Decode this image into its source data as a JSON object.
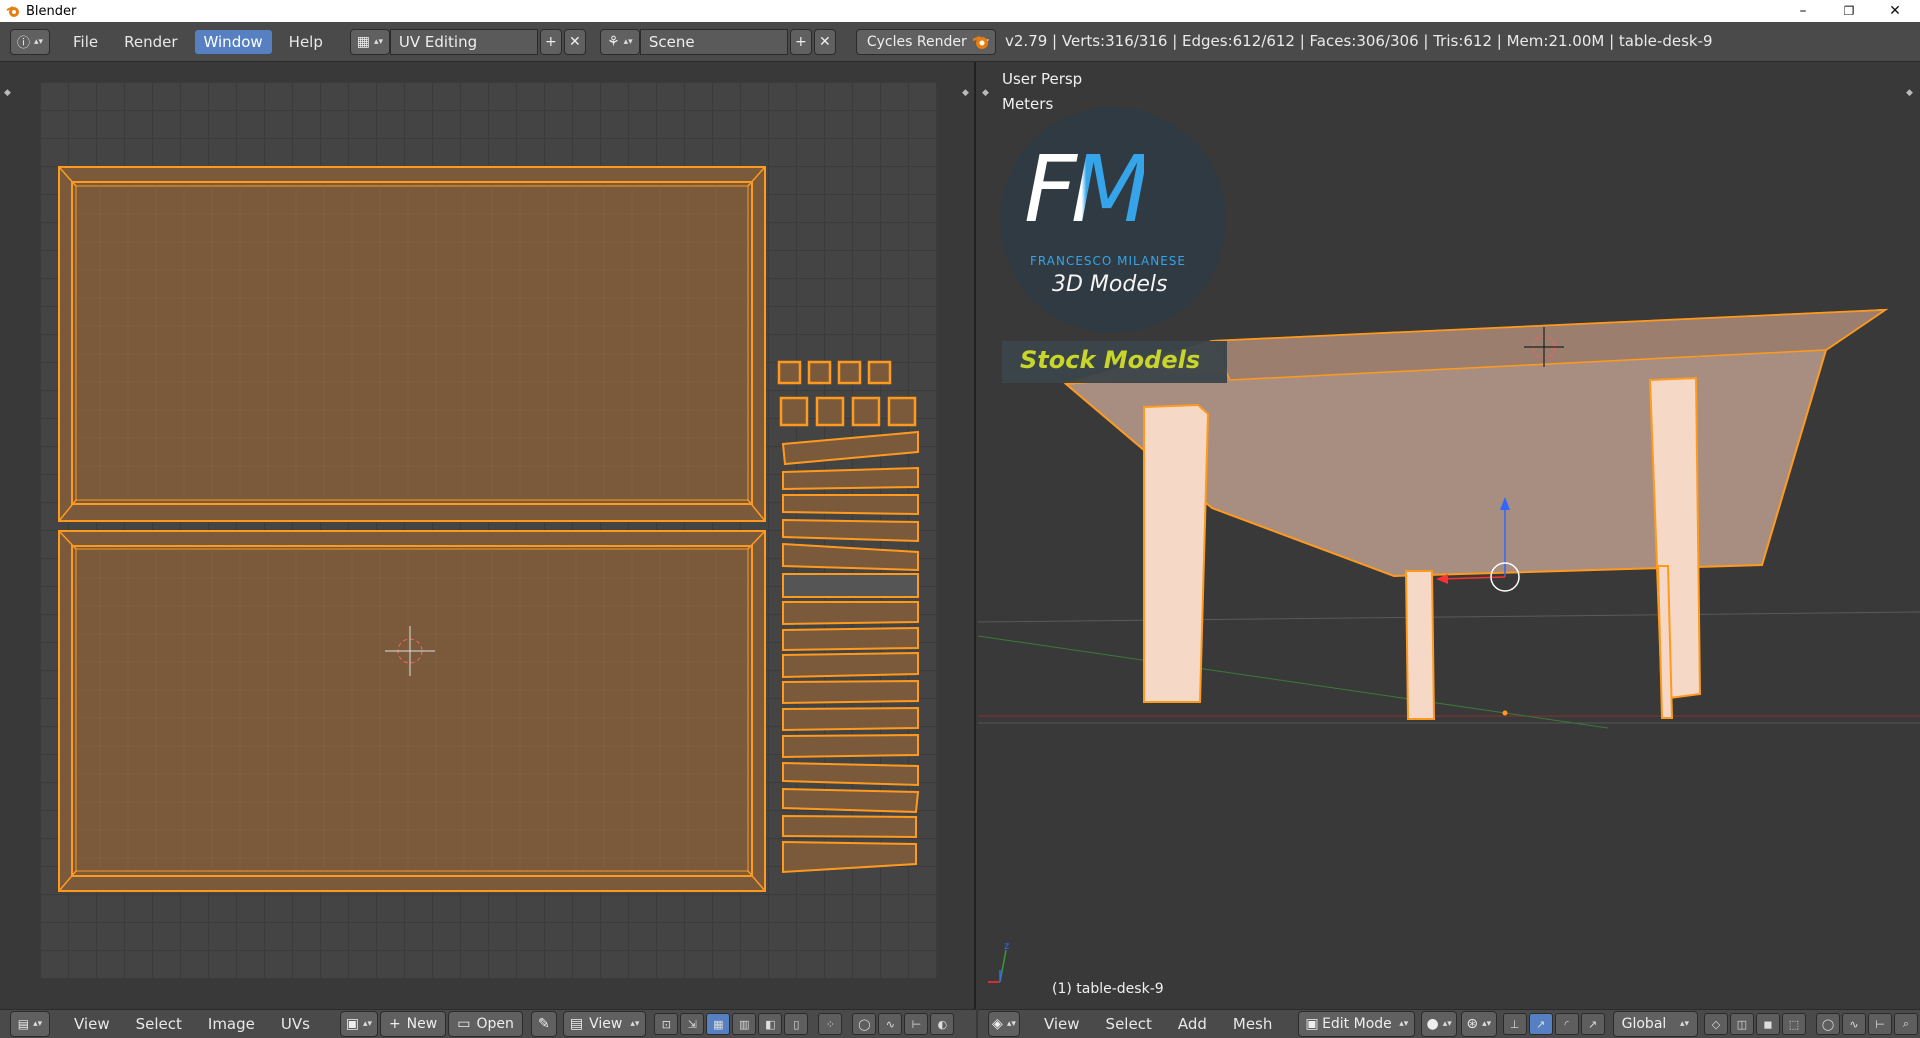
{
  "window": {
    "title": "Blender",
    "minimize": "–",
    "maximize": "❐",
    "close": "✕"
  },
  "infobar": {
    "menus": [
      "File",
      "Render",
      "Window",
      "Help"
    ],
    "active_menu": "Window",
    "screen_layout": "UV Editing",
    "scene": "Scene",
    "render_engine": "Cycles Render",
    "stats": "v2.79 | Verts:316/316 | Edges:612/612 | Faces:306/306 | Tris:612 | Mem:21.00M | table-desk-9"
  },
  "uv_editor": {
    "header_menus": [
      "View",
      "Select",
      "Image",
      "UVs"
    ],
    "new_label": "New",
    "open_label": "Open",
    "view_label": "View"
  },
  "viewport": {
    "view_name": "User Persp",
    "units": "Meters",
    "object_label": "(1) table-desk-9",
    "header_menus": [
      "View",
      "Select",
      "Add",
      "Mesh"
    ],
    "mode": "Edit Mode",
    "orientation": "Global",
    "watermark": {
      "brand_letters": "FM",
      "brand_name": "FRANCESCO MILANESE",
      "tagline": "3D Models",
      "banner": "Stock Models"
    }
  },
  "colors": {
    "accent": "#5680c2",
    "uv_fill": "#7a5a3a",
    "uv_edge": "#ff9a1f",
    "mesh_fill": "#c8a28a"
  }
}
